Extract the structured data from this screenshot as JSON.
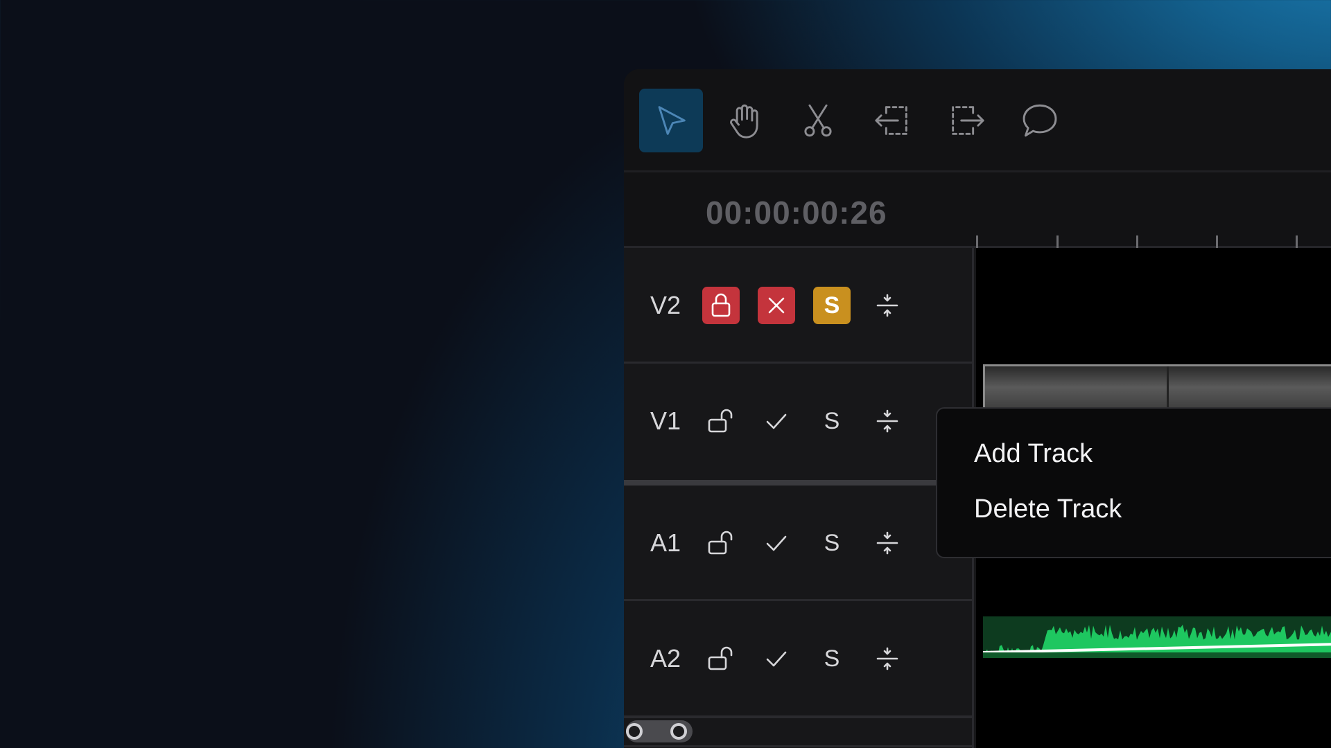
{
  "toolbar": {
    "tools": [
      {
        "name": "select",
        "icon": "cursor-arrow-icon",
        "active": true
      },
      {
        "name": "hand",
        "icon": "hand-icon",
        "active": false
      },
      {
        "name": "razor",
        "icon": "scissors-icon",
        "active": false
      },
      {
        "name": "trim-left",
        "icon": "trim-left-icon",
        "active": false
      },
      {
        "name": "trim-right",
        "icon": "trim-right-icon",
        "active": false
      },
      {
        "name": "comment",
        "icon": "speech-bubble-icon",
        "active": false
      }
    ]
  },
  "timecode": "00:00:00:26",
  "tracks": [
    {
      "label": "V2",
      "locked": true,
      "disabled": true,
      "solo": true,
      "solo_label": "S"
    },
    {
      "label": "V1",
      "locked": false,
      "disabled": false,
      "solo": false,
      "solo_label": "S"
    },
    {
      "label": "A1",
      "locked": false,
      "disabled": false,
      "solo": false,
      "solo_label": "S"
    },
    {
      "label": "A2",
      "locked": false,
      "disabled": false,
      "solo": false,
      "solo_label": "S"
    }
  ],
  "context_menu": {
    "items": [
      "Add Track",
      "Delete Track"
    ]
  },
  "colors": {
    "accent_active_tool": "#0d3a57",
    "lock_active": "#c4343c",
    "solo_active": "#c9901f",
    "audio_waveform": "#1ec760"
  }
}
